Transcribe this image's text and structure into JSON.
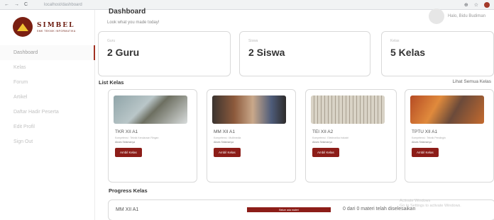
{
  "browser": {
    "nav_back": "←",
    "nav_forward": "→",
    "nav_reload": "C",
    "url": "localhost/dashboard",
    "icons": [
      "extension-icon",
      "star-icon",
      "profile-icon"
    ]
  },
  "sidebar": {
    "logo": {
      "brand": "SIMBEL",
      "tagline": "SMK TEKNIK INFORMATIKA"
    },
    "items": [
      {
        "label": "Dashboard",
        "active": true
      },
      {
        "label": "Kelas"
      },
      {
        "label": "Forum"
      },
      {
        "label": "Artikel"
      },
      {
        "label": "Daftar Hadir Peserta"
      },
      {
        "label": "Edit Profil"
      },
      {
        "label": "Sign Out"
      }
    ]
  },
  "header": {
    "title": "Dashboard",
    "subtitle": "Look what you made today!",
    "user": {
      "name": "Halo, Bidu Budiman"
    }
  },
  "stats": [
    {
      "label": "Guru",
      "value": "2 Guru"
    },
    {
      "label": "Siswa",
      "value": "2 Siswa"
    },
    {
      "label": "Kelas",
      "value": "5 Kelas"
    }
  ],
  "list_kelas": {
    "heading": "List Kelas",
    "see_all": "Lihat Semua Kelas",
    "cards": [
      {
        "name": "TKR XII A1",
        "meta": "Kompetensi : Teknik Kendaraan Ringan",
        "status": "Akses Selamanya",
        "button": "Ambil Kelas"
      },
      {
        "name": "MM XII A1",
        "meta": "Kompetensi : Multimedia",
        "status": "Akses Selamanya",
        "button": "Ambil Kelas"
      },
      {
        "name": "TEI XII A2",
        "meta": "Kompetensi : Elektronika Industri",
        "status": "Akses Selamanya",
        "button": "Ambil Kelas"
      },
      {
        "name": "TPTU XII A1",
        "meta": "Kompetensi : Teknik Pendingin",
        "status": "Akses Selamanya",
        "button": "Ambil Kelas"
      }
    ]
  },
  "progress": {
    "heading": "Progress Kelas",
    "rows": [
      {
        "name": "MM XII A1",
        "bar_label": "Belum ada materi",
        "text": "0 dari 0 materi telah diselesaikan"
      }
    ]
  },
  "watermark": {
    "line1": "Activate Windows",
    "line2": "Go to Settings to activate Windows."
  }
}
